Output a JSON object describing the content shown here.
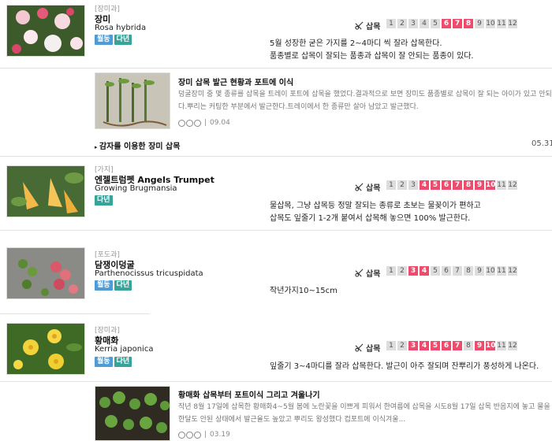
{
  "entries": [
    {
      "family": "[장미과]",
      "name_ko": "장미",
      "name_sci": "Rosa hybrida",
      "badges": [
        "월동",
        "다년"
      ],
      "method": "삽목",
      "active_months": [
        6,
        7,
        8
      ],
      "desc_lines": [
        "5월 성장한 굳은 가지를 2~4마디 씩 잘라 삽목한다.",
        "품종별로 삽목이 잘되는 품종과 삽목이 잘 안되는 품종이 있다."
      ],
      "image_icon": "rose-photo"
    },
    {
      "family": "[가지]",
      "name_ko": "엔젤트럼펫 Angels Trumpet",
      "name_sci": "Growing Brugmansia",
      "badges": [
        "다년"
      ],
      "method": "삽목",
      "active_months": [
        4,
        5,
        6,
        7,
        8,
        9,
        10
      ],
      "desc_lines": [
        "물삽목, 그냥 삽목등 정말 잘되는 종류로 초보는 물꽂이가 편하고",
        "삽목도 잎줄기 1-2개 붙여서 삽목해 놓으면 100% 발근한다."
      ],
      "image_icon": "brugmansia-photo"
    },
    {
      "family": "[포도과]",
      "name_ko": "담쟁이덩굴",
      "name_sci": "Parthenocissus tricuspidata",
      "badges": [
        "월동",
        "다년"
      ],
      "method": "삽목",
      "active_months": [
        3,
        4
      ],
      "desc_lines": [
        "작년가지10~15cm"
      ],
      "image_icon": "ivy-photo"
    },
    {
      "family": "[장미과]",
      "name_ko": "황매화",
      "name_sci": "Kerria japonica",
      "badges": [
        "월동",
        "다년"
      ],
      "method": "삽목",
      "active_months": [
        3,
        4,
        5,
        6,
        7,
        9,
        10
      ],
      "desc_lines": [
        "잎줄기 3~4마디를 잘라 삽목한다. 발근이 아주 잘되며 잔뿌리가 풍성하게 나온다."
      ],
      "image_icon": "kerria-photo"
    }
  ],
  "months": [
    "1",
    "2",
    "3",
    "4",
    "5",
    "6",
    "7",
    "8",
    "9",
    "10",
    "11",
    "12"
  ],
  "posts": [
    {
      "title": "장미 삽목 발근 현황과 포트에 이식",
      "body_lines": [
        "덩굴장미 중 몇 종류를 삽목을 트레이 포트에 삽목을 했었다.결과적으로 보면 장미도 품종별로 삽목이 잘 되는 아이가 있고 안되는 아이가 있다.",
        "다.뿌리는 커팅한 부분에서 발근한다.트레이에서 한 종류만 살아 남았고 발근했다."
      ],
      "date": "09.04"
    },
    {
      "title": "황매화 삽목부터 포트이식 그리고 겨울나기",
      "body_lines": [
        "작년 8월 17일에 삽목한 황매화4~5월 봄에 노란꽃을 이쁘게 피워서 한여름에 삽목을 시도8월 17일 삽목 반음지에 놓고 물을 잘줬다.9월 4일",
        "한달도 안된 상태에서 발근율도 높았고 뿌리도 왕성했다 컵포트에 이식겨울..."
      ],
      "date": "03.19"
    }
  ],
  "link": {
    "title": "감자를 이용한 장미 삽목",
    "date": "05.31"
  },
  "colors": {
    "active_month": "#ef4c6d",
    "inactive_month": "#dddddd",
    "badge_winter": "#4f9bd6",
    "badge_perennial": "#36a49a"
  }
}
